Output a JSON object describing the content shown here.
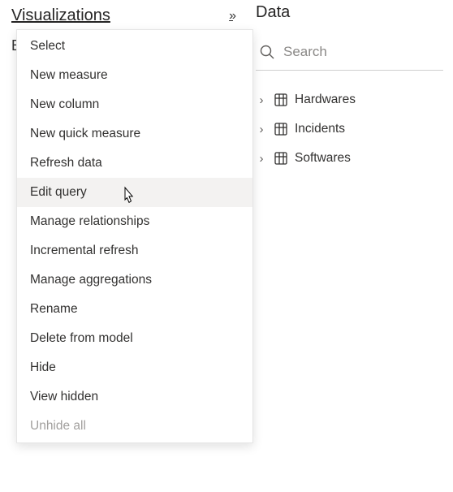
{
  "panes": {
    "visualizations": {
      "title": "Visualizations"
    },
    "data": {
      "title": "Data"
    }
  },
  "partial_behind": "E",
  "context_menu": {
    "items": [
      {
        "label": "Select",
        "state": "normal"
      },
      {
        "label": "New measure",
        "state": "normal"
      },
      {
        "label": "New column",
        "state": "normal"
      },
      {
        "label": "New quick measure",
        "state": "normal"
      },
      {
        "label": "Refresh data",
        "state": "normal"
      },
      {
        "label": "Edit query",
        "state": "hovered"
      },
      {
        "label": "Manage relationships",
        "state": "normal"
      },
      {
        "label": "Incremental refresh",
        "state": "normal"
      },
      {
        "label": "Manage aggregations",
        "state": "normal"
      },
      {
        "label": "Rename",
        "state": "normal"
      },
      {
        "label": "Delete from model",
        "state": "normal"
      },
      {
        "label": "Hide",
        "state": "normal"
      },
      {
        "label": "View hidden",
        "state": "normal"
      },
      {
        "label": "Unhide all",
        "state": "disabled"
      }
    ]
  },
  "search": {
    "placeholder": "Search",
    "value": ""
  },
  "tables": [
    {
      "name": "Hardwares"
    },
    {
      "name": "Incidents"
    },
    {
      "name": "Softwares"
    }
  ]
}
